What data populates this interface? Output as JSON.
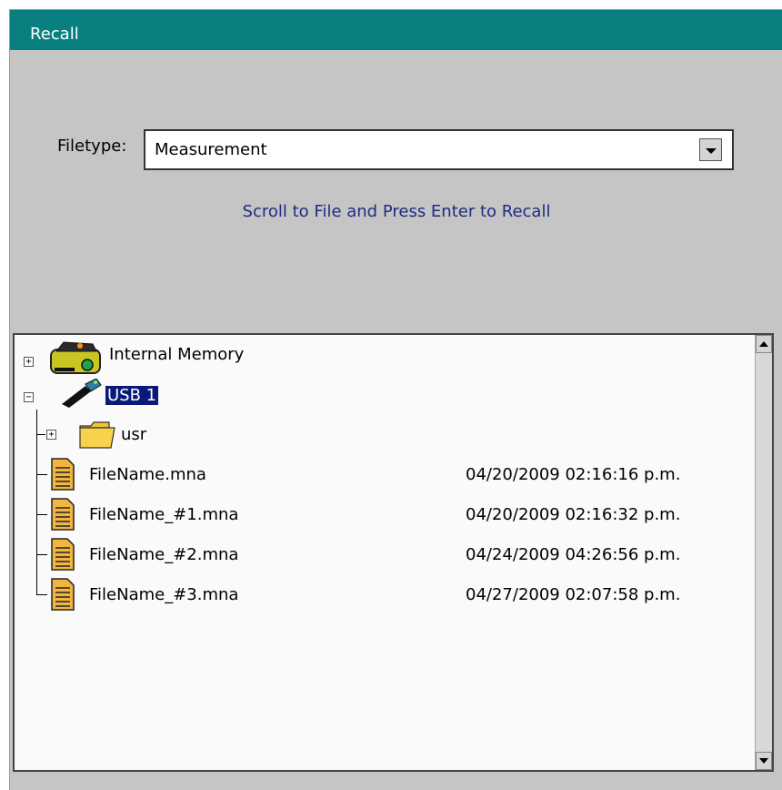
{
  "window": {
    "title": "Recall"
  },
  "filetype": {
    "label": "Filetype:",
    "value": "Measurement"
  },
  "hint": "Scroll to File and Press Enter to Recall",
  "tree": {
    "internal_memory": {
      "label": "Internal Memory",
      "toggle": "+"
    },
    "usb": {
      "label": "USB 1",
      "toggle": "−"
    },
    "usr": {
      "label": "usr",
      "toggle": "+"
    },
    "files": [
      {
        "name": "FileName.mna",
        "date": "04/20/2009 02:16:16 p.m."
      },
      {
        "name": "FileName_#1.mna",
        "date": "04/20/2009 02:16:32 p.m."
      },
      {
        "name": "FileName_#2.mna",
        "date": "04/24/2009 04:26:56 p.m."
      },
      {
        "name": "FileName_#3.mna",
        "date": "04/27/2009 02:07:58 p.m."
      }
    ]
  },
  "icons": {
    "internal_memory": "memory-card-icon",
    "usb": "usb-drive-icon",
    "folder": "folder-icon",
    "file": "document-icon"
  },
  "colors": {
    "title_bar": "#0a7f80",
    "hint_text": "#1e2b82",
    "selection": "#0a1a7a",
    "panel_bg": "#c5c5c5"
  }
}
